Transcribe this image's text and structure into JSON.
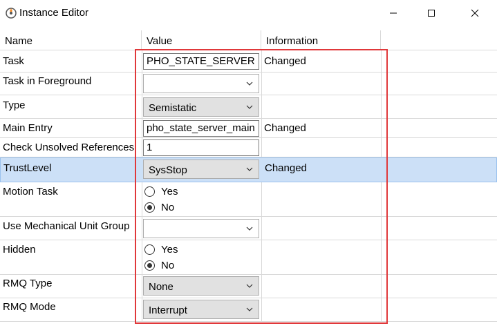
{
  "window": {
    "title": "Instance Editor",
    "icon": "app-icon",
    "minimize_icon": "minimize-icon",
    "maximize_icon": "maximize-icon",
    "close_icon": "close-icon"
  },
  "columns": {
    "name": "Name",
    "value": "Value",
    "information": "Information"
  },
  "rows": {
    "task": {
      "name": "Task",
      "value": "PHO_STATE_SERVER",
      "info": "Changed"
    },
    "task_in_foreground": {
      "name": "Task in Foreground",
      "value": ""
    },
    "type": {
      "name": "Type",
      "value": "Semistatic"
    },
    "main_entry": {
      "name": "Main Entry",
      "value": "pho_state_server_main",
      "info": "Changed"
    },
    "check_unsolved": {
      "name": "Check Unsolved References",
      "value": "1"
    },
    "trust_level": {
      "name": "TrustLevel",
      "value": "SysStop",
      "info": "Changed"
    },
    "motion_task": {
      "name": "Motion Task",
      "option_yes": "Yes",
      "option_no": "No",
      "selected": "No"
    },
    "use_mech_unit_group": {
      "name": "Use Mechanical Unit Group",
      "value": ""
    },
    "hidden": {
      "name": "Hidden",
      "option_yes": "Yes",
      "option_no": "No",
      "selected": "No"
    },
    "rmq_type": {
      "name": "RMQ Type",
      "value": "None"
    },
    "rmq_mode": {
      "name": "RMQ Mode",
      "value": "Interrupt"
    }
  },
  "colors": {
    "selection": "#cce0f7",
    "highlight_border": "#e0383a",
    "grid_line": "#d9d9d9"
  }
}
